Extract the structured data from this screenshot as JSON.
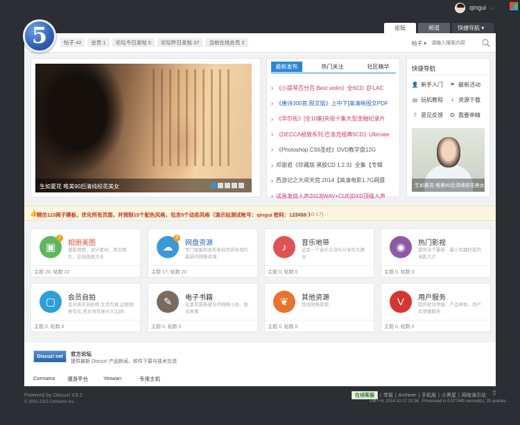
{
  "user": {
    "name": "qingui"
  },
  "nav_tabs": [
    "论坛",
    "频道",
    "快捷导航"
  ],
  "stats": [
    "帖子 42",
    "会员 1",
    "论坛今日发帖 5",
    "论坛昨日发帖 37",
    "当前在线会员 2"
  ],
  "search": {
    "scope": "帖子",
    "placeholder": "请输入搜索内容"
  },
  "slider": {
    "caption": "生如夏花 唯美90后清纯校花美女"
  },
  "news": {
    "tabs": [
      "最新发布",
      "热门关注",
      "社区精华"
    ],
    "items": [
      {
        "text": "《小提琴百分百.Best violin》全6CD【FLAC",
        "color": "#d6336c"
      },
      {
        "text": "《唐诗300首.图文版》上中下[高清晰图文PDF",
        "color": "#1f63c4"
      },
      {
        "text": "《华尔街》[全10集]央视十集大型金融纪录片",
        "color": "#d6336c"
      },
      {
        "text": "《DECCA極致系列.巴洛克經典5CD》Ultimate",
        "color": "#d6336c"
      },
      {
        "text": "《Photoshop CS6圣经》DVD教学盘12G",
        "color": "#555555"
      },
      {
        "text": "邓丽君《珍藏版 黑胶CD 1.2.3》全集【专辑",
        "color": "#555555"
      },
      {
        "text": "西游记之大闹天宫.2014【高清电影1.7G网盘",
        "color": "#555555"
      },
      {
        "text": "试音发烧人声2013[WAV+CUE]DXD顶级人声",
        "color": "#d6336c"
      }
    ]
  },
  "quick": {
    "title": "快捷导航",
    "items": [
      {
        "label": "新手入门",
        "icon": "user-icon"
      },
      {
        "label": "最新活动",
        "icon": "flag-icon"
      },
      {
        "label": "玩机教程",
        "icon": "book-icon"
      },
      {
        "label": "资源下载",
        "icon": "download-icon"
      },
      {
        "label": "意见反馈",
        "icon": "question-icon"
      },
      {
        "label": "我要申精",
        "icon": "badge-icon"
      }
    ],
    "caption": "生如夏花 唯美90后清纯校花美女"
  },
  "notice": {
    "text": "精仿115网子模板，优化所有页面，并预制15个配色风格，包含5个动态风格（演示站测试帐号：qingui  密码：123456 ）",
    "date": "(2014-10-17)"
  },
  "forums": [
    {
      "title": "相册美图",
      "title_color": "#e74c3c",
      "desc": "摄影观图、设计素材、美女图片、在线画画大全",
      "stats": "主题 20, 帖数 22",
      "icon_color": "#5cb85c",
      "icon": "image-icon",
      "badge": "2"
    },
    {
      "title": "网盘资源",
      "title_color": "#1f63c4",
      "desc": "专门收集和发布来自世界各地的最新的网络资源",
      "stats": "主题 17, 帖数 20",
      "icon_color": "#3a9ad9",
      "icon": "cloud-icon",
      "badge": "3"
    },
    {
      "title": "音乐地带",
      "title_color": "#333333",
      "desc": "这是一个音乐交流与分享的大舞台",
      "stats": "主题 0, 帖数 0",
      "icon_color": "#e05252",
      "icon": "music-icon",
      "badge": ""
    },
    {
      "title": "热门影视",
      "title_color": "#333333",
      "desc": "提供当下最新、最火有趣好看的电影大片",
      "stats": "主题 0, 帖数 0",
      "icon_color": "#8e5aa6",
      "icon": "film-icon",
      "badge": ""
    },
    {
      "title": "会员自拍",
      "title_color": "#333333",
      "desc": "会员真实自拍照,生活写真,边框相册专区,美女帅哥展示大比拼!",
      "stats": "主题 0, 帖数 0",
      "icon_color": "#2d9fd8",
      "icon": "portrait-icon",
      "badge": ""
    },
    {
      "title": "电子书籍",
      "title_color": "#333333",
      "desc": "这里有最新最全的网络小说、励志故事",
      "stats": "主题 0, 帖数 0",
      "icon_color": "#7a6a60",
      "icon": "pen-icon",
      "badge": ""
    },
    {
      "title": "其他资源",
      "title_color": "#333333",
      "desc": "其他网络资源",
      "stats": "主题 0, 帖数 0",
      "icon_color": "#e8732c",
      "icon": "leaf-icon",
      "badge": ""
    },
    {
      "title": "用户服务",
      "title_color": "#333333",
      "desc": "提供投诉举报、产品帮助、用户反馈播服务",
      "stats": "主题 0, 帖数 0",
      "icon_color": "#d8352f",
      "icon": "vip-icon",
      "badge": ""
    }
  ],
  "links": {
    "logo_text": "Discuz! net",
    "title": "官方论坛",
    "desc": "提供最新 Discuz! 产品新闻、软件下载与技术交流",
    "partners": [
      "Comsenz",
      "漫游平台",
      "Yeswan",
      "专用主机"
    ]
  },
  "footer": {
    "powered": "Powered by Discuz! X3.2",
    "copyright": "© 2001-2013 Comsenz Inc.",
    "badge": "在线客服",
    "links": [
      "举报",
      "Archiver",
      "手机版",
      "小黑屋",
      "网络演示站"
    ],
    "stats": "GMT+8, 2014-10-17 22:36 , Processed in 0.077449 second(s), 25 queries ."
  }
}
